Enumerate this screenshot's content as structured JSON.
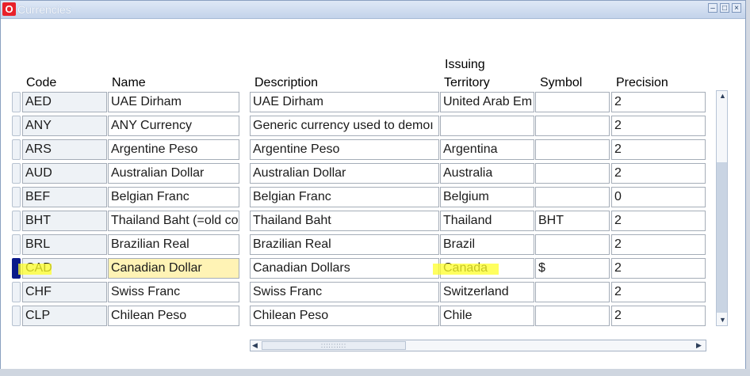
{
  "window": {
    "title": "Currencies"
  },
  "columns": {
    "code": "Code",
    "name": "Name",
    "description": "Description",
    "territory_line1": "Issuing",
    "territory_line2": "Territory",
    "symbol": "Symbol",
    "precision": "Precision"
  },
  "rows": [
    {
      "code": "AED",
      "name": "UAE Dirham",
      "description": "UAE Dirham",
      "territory": "United Arab Em",
      "symbol": "",
      "precision": "2"
    },
    {
      "code": "ANY",
      "name": "ANY Currency",
      "description": "Generic currency used to demoı",
      "territory": "",
      "symbol": "",
      "precision": "2"
    },
    {
      "code": "ARS",
      "name": "Argentine Peso",
      "description": "Argentine Peso",
      "territory": "Argentina",
      "symbol": "",
      "precision": "2"
    },
    {
      "code": "AUD",
      "name": "Australian Dollar",
      "description": "Australian Dollar",
      "territory": "Australia",
      "symbol": "",
      "precision": "2"
    },
    {
      "code": "BEF",
      "name": "Belgian Franc",
      "description": "Belgian Franc",
      "territory": "Belgium",
      "symbol": "",
      "precision": "0"
    },
    {
      "code": "BHT",
      "name": "Thailand Baht (=old co",
      "description": "Thailand Baht",
      "territory": "Thailand",
      "symbol": "BHT",
      "precision": "2"
    },
    {
      "code": "BRL",
      "name": "Brazilian Real",
      "description": "Brazilian Real",
      "territory": "Brazil",
      "symbol": "",
      "precision": "2"
    },
    {
      "code": "CAD",
      "name": "Canadian Dollar",
      "description": "Canadian Dollars",
      "territory": "Canada",
      "symbol": "$",
      "precision": "2"
    },
    {
      "code": "CHF",
      "name": "Swiss Franc",
      "description": "Swiss Franc",
      "territory": "Switzerland",
      "symbol": "",
      "precision": "2"
    },
    {
      "code": "CLP",
      "name": "Chilean Peso",
      "description": "Chilean Peso",
      "territory": "Chile",
      "symbol": "",
      "precision": "2"
    }
  ],
  "current_row_index": 7,
  "colors": {
    "highlight": "#ffff2a",
    "current_name_bg": "#fff3b5",
    "selector_active": "#0a1a8a"
  },
  "icons": {
    "app": "oracle-icon",
    "minimize": "minimize-icon",
    "maximize": "maximize-icon",
    "close": "close-icon"
  }
}
